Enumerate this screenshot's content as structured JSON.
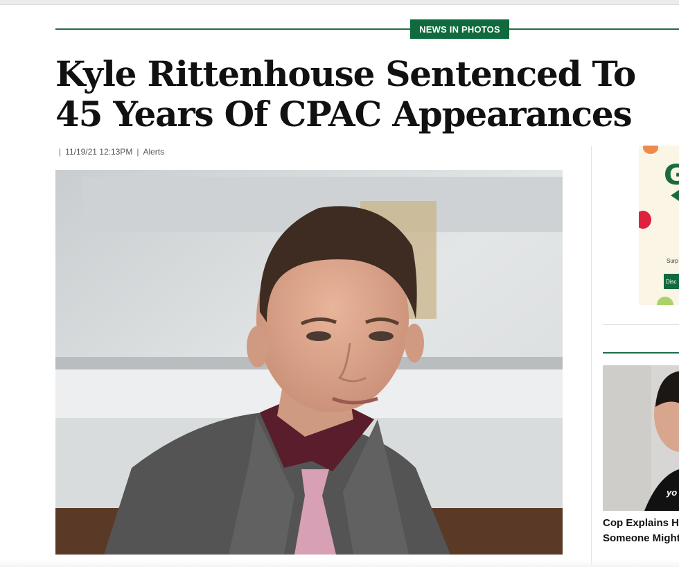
{
  "section": {
    "tag": "NEWS IN PHOTOS"
  },
  "article": {
    "headline": "Kyle Rittenhouse Sentenced To 45 Years Of CPAC Appearances",
    "byline": {
      "sep1": "|",
      "timestamp": "11/19/21 12:13PM",
      "sep2": "|",
      "category": "Alerts"
    }
  },
  "sidebar": {
    "ad": {
      "brand_letter": "G",
      "text_fragment": "Surp",
      "button_fragment": "Disc"
    },
    "related": {
      "thumb_caption": "yo",
      "title_line1": "Cop Explains How",
      "title_line2": "Someone Might R"
    }
  },
  "colors": {
    "accent_green": "#0f6a3e",
    "headline": "#111111"
  }
}
